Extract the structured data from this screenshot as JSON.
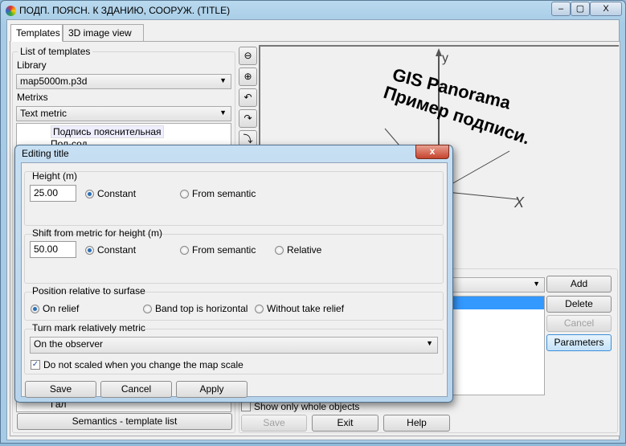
{
  "window": {
    "title": "ПОДП. ПОЯСН. К ЗДАНИЮ, СООРУЖ. (TITLE)",
    "minimize": "–",
    "maximize": "▢",
    "close": "X"
  },
  "tabs": [
    {
      "label": "Templates",
      "active": true
    },
    {
      "label": "3D image view",
      "active": false
    }
  ],
  "left": {
    "group_title": "List of templates",
    "library_label": "Library",
    "library_value": "map5000m.p3d",
    "metrics_label": "Metrixs",
    "metrics_value": "Text metric",
    "tree_items": [
      "Подпись пояснительная",
      "Пол-сод",
      "Гал"
    ],
    "semantics_button": "Semantics - template list"
  },
  "toolbar": {
    "zoom_out": "zoom-out-icon",
    "zoom_in": "zoom-in-icon",
    "rotate_z_left": "rotate-z-left-icon",
    "rotate_z_right": "rotate-z-right-icon",
    "rotate_y": "rotate-y-icon"
  },
  "view3d": {
    "line1": "GIS Panorama",
    "line2": "Пример подписи.",
    "axis_y": "y",
    "axis_x": "X"
  },
  "right": {
    "add": "Add",
    "delete": "Delete",
    "cancel": "Cancel",
    "parameters": "Parameters",
    "show_whole": "Show only whole objects",
    "show_whole_checked": false,
    "save": "Save",
    "exit": "Exit",
    "help": "Help"
  },
  "dialog": {
    "title": "Editing title",
    "close": "x",
    "height": {
      "label": "Height (m)",
      "value": "25.00",
      "opt_constant": "Constant",
      "opt_semantic": "From semantic",
      "selected": "Constant"
    },
    "shift": {
      "label": "Shift from metric for height (m)",
      "value": "50.00",
      "opt_constant": "Constant",
      "opt_semantic": "From semantic",
      "opt_relative": "Relative",
      "selected": "Constant"
    },
    "position": {
      "label": "Position relative to surfase",
      "opt_relief": "On relief",
      "opt_band": "Band top is horizontal",
      "opt_without": "Without take relief",
      "selected": "On relief"
    },
    "turn": {
      "label": "Turn mark relatively metric",
      "value": "On the observer",
      "no_scale_label": "Do not scaled when you change the map scale",
      "no_scale_checked": true
    },
    "save": "Save",
    "cancel": "Cancel",
    "apply": "Apply"
  }
}
